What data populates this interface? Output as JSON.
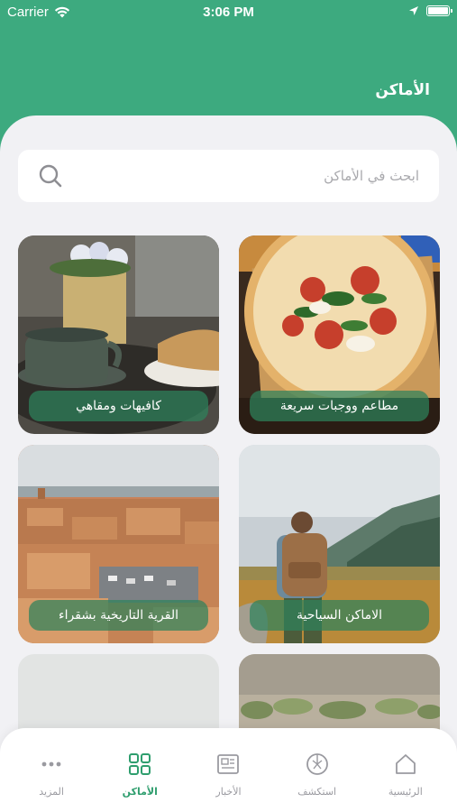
{
  "status_bar": {
    "carrier": "Carrier",
    "time": "3:06 PM"
  },
  "header": {
    "title": "الأماكن"
  },
  "search": {
    "placeholder": "ابحث في الأماكن"
  },
  "categories": [
    {
      "label": "مطاعم ووجبات سريعة",
      "image": "pizza"
    },
    {
      "label": "كافيهات ومقاهي",
      "image": "coffee"
    },
    {
      "label": "الاماكن السياحية",
      "image": "hiker"
    },
    {
      "label": "القرية التاريخية بشقراء",
      "image": "historic-village"
    },
    {
      "label": "",
      "image": "desert-plants"
    },
    {
      "label": "",
      "image": "blank"
    }
  ],
  "tabbar": {
    "items": [
      {
        "label": "الرئيسية",
        "icon": "home-icon"
      },
      {
        "label": "استكشف",
        "icon": "explore-icon"
      },
      {
        "label": "الأخبار",
        "icon": "news-icon"
      },
      {
        "label": "الأماكن",
        "icon": "grid-icon",
        "active": true
      },
      {
        "label": "المزيد",
        "icon": "more-icon"
      }
    ]
  },
  "colors": {
    "brand": "#3daa7f",
    "active_tab": "#2f9e6e"
  }
}
